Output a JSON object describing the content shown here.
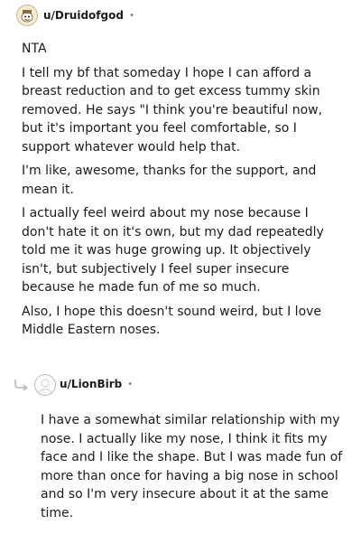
{
  "comment": {
    "username": "u/Druidofgod",
    "separator": "•",
    "paragraphs": [
      "NTA",
      "I tell my bf that someday I hope I can afford a breast reduction and to get excess tummy skin removed. He says \"I think you're beautiful now, but it's important you feel comfortable, so I support whatever would help that.",
      "I'm like, awesome, thanks for the support, and mean it.",
      "I actually feel weird about my nose because I don't hate it on it's own, but my dad repeatedly told me it was huge growing up. It objectively isn't, but subjectively I feel super insecure because he made fun of me so much.",
      "Also, I hope this doesn't sound weird, but I love Middle Eastern noses."
    ]
  },
  "reply": {
    "username": "u/LionBirb",
    "separator": "•",
    "text": "I have a somewhat similar relationship with my nose. I actually like my nose, I think it fits my face and I like the shape. But I was made fun of more than once for having a big nose in school and so I'm very insecure about it at the same time."
  },
  "icons": {
    "avatar1": "snoo-avatar-icon",
    "avatar2": "default-avatar-icon",
    "reply": "reply-arrow-icon"
  }
}
